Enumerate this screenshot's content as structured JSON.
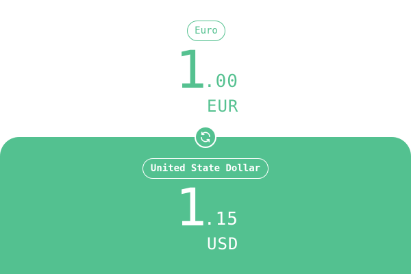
{
  "from": {
    "currency_name": "Euro",
    "integer": "1",
    "decimals": ".00",
    "code": "EUR"
  },
  "to": {
    "currency_name": "United State Dollar",
    "integer": "1",
    "decimals": ".15",
    "code": "USD"
  },
  "swap_icon": "refresh-icon",
  "colors": {
    "accent": "#53c190",
    "background": "#ffffff",
    "text_on_accent": "#ffffff"
  }
}
